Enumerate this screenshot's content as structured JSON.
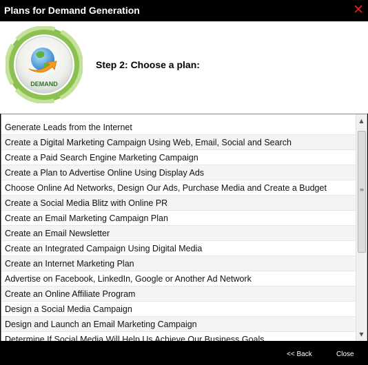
{
  "window": {
    "title": "Plans for Demand Generation",
    "close_glyph": "✕"
  },
  "logo": {
    "label": "DEMAND",
    "icon": "globe-arrow-icon"
  },
  "step_label": "Step 2: Choose a plan:",
  "plans": [
    "Generate Leads from the Internet",
    "Create a Digital Marketing Campaign Using Web, Email, Social and Search",
    "Create a Paid Search Engine Marketing Campaign",
    "Create a Plan to Advertise Online Using Display Ads",
    "Choose Online Ad Networks, Design Our Ads, Purchase Media and Create a Budget",
    "Create a Social Media Blitz with Online PR",
    "Create an Email Marketing Campaign Plan",
    "Create an Email Newsletter",
    "Create an Integrated Campaign Using Digital Media",
    "Create an Internet Marketing Plan",
    "Advertise on Facebook, LinkedIn, Google or Another Ad Network",
    "Create an Online Affiliate Program",
    "Design a Social Media Campaign",
    "Design and Launch an Email Marketing Campaign",
    "Determine If Social Media Will Help Us Achieve Our Business Goals"
  ],
  "scrollbar": {
    "up": "▲",
    "down": "▼",
    "grip": "≡"
  },
  "footer": {
    "back_label": "<< Back",
    "close_label": "Close"
  },
  "colors": {
    "ring_green": "#9ccc62",
    "close_red": "#e0201c",
    "chrome": "#000000"
  }
}
